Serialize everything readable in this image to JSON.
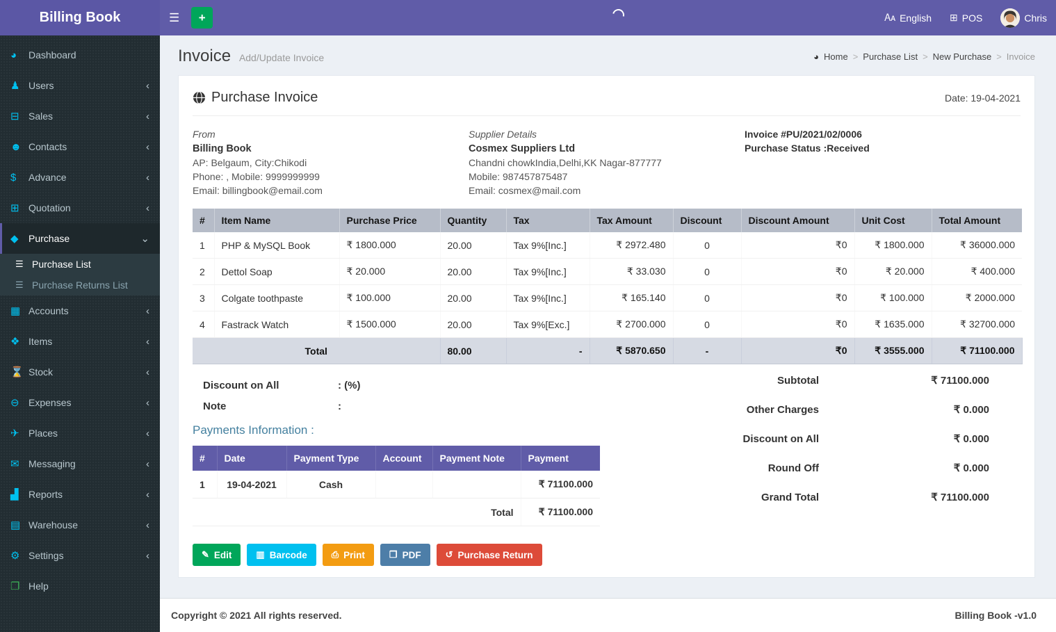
{
  "header": {
    "brand": "Billing Book",
    "language_label": "English",
    "pos_label": "POS",
    "user_name": "Chris",
    "icons": [
      "hamburger-icon",
      "plus-icon",
      "language-icon",
      "pos-plus-icon",
      "avatar",
      "loading-spinner"
    ]
  },
  "colors": {
    "navbar_purple": "#605ca8",
    "sidebar_dark": "#222d32",
    "icon_cyan": "#00c0ef",
    "green": "#00a65a",
    "orange": "#f39c12",
    "pdf_blue": "#4d7ea8",
    "red": "#dd4b39",
    "items_header_gray": "#b6bcc8",
    "total_row_gray": "#d6dae3"
  },
  "sidebar": {
    "items": [
      {
        "label": "Dashboard",
        "icon": "gauge-icon"
      },
      {
        "label": "Users",
        "icon": "user-plus-icon"
      },
      {
        "label": "Sales",
        "icon": "cart-icon"
      },
      {
        "label": "Contacts",
        "icon": "people-icon"
      },
      {
        "label": "Advance",
        "icon": "dollar-icon"
      },
      {
        "label": "Quotation",
        "icon": "calendar-plus-icon"
      },
      {
        "label": "Purchase",
        "icon": "cube-icon",
        "active": true,
        "expanded": true
      },
      {
        "label": "Accounts",
        "icon": "grid-icon"
      },
      {
        "label": "Items",
        "icon": "cubes-icon"
      },
      {
        "label": "Stock",
        "icon": "hourglass-icon"
      },
      {
        "label": "Expenses",
        "icon": "minus-circle-icon"
      },
      {
        "label": "Places",
        "icon": "paper-plane-icon"
      },
      {
        "label": "Messaging",
        "icon": "envelope-icon"
      },
      {
        "label": "Reports",
        "icon": "bar-chart-icon"
      },
      {
        "label": "Warehouse",
        "icon": "building-icon"
      },
      {
        "label": "Settings",
        "icon": "gears-icon"
      },
      {
        "label": "Help",
        "icon": "book-icon"
      }
    ],
    "purchase_submenu": [
      {
        "label": "Purchase List",
        "icon": "list-icon",
        "active": true
      },
      {
        "label": "Purchase Returns List",
        "icon": "list-icon",
        "active": false
      }
    ]
  },
  "page": {
    "title": "Invoice",
    "subtitle": "Add/Update Invoice",
    "breadcrumb": [
      {
        "label": "Home"
      },
      {
        "label": "Purchase List"
      },
      {
        "label": "New Purchase"
      },
      {
        "label": "Invoice"
      }
    ]
  },
  "invoice": {
    "title": "Purchase Invoice",
    "date": "Date: 19-04-2021",
    "from": {
      "heading": "From",
      "name": "Billing Book",
      "address": "AP: Belgaum, City:Chikodi",
      "phone": "Phone: , Mobile: 9999999999",
      "email": "Email: billingbook@email.com"
    },
    "supplier": {
      "heading": "Supplier Details",
      "name": "Cosmex Suppliers Ltd",
      "address": "Chandni chowkIndia,Delhi,KK Nagar-877777",
      "mobile": "Mobile: 987457875487",
      "email": "Email: cosmex@mail.com"
    },
    "meta": {
      "invoice_no": "Invoice #PU/2021/02/0006",
      "status": "Purchase Status :Received"
    }
  },
  "items_table": {
    "headers": [
      "#",
      "Item Name",
      "Purchase Price",
      "Quantity",
      "Tax",
      "Tax Amount",
      "Discount",
      "Discount Amount",
      "Unit Cost",
      "Total Amount"
    ],
    "rows": [
      [
        "1",
        "PHP & MySQL Book",
        "₹ 1800.000",
        "20.00",
        "Tax 9%[Inc.]",
        "₹ 2972.480",
        "0",
        "₹0",
        "₹ 1800.000",
        "₹ 36000.000"
      ],
      [
        "2",
        "Dettol Soap",
        "₹ 20.000",
        "20.00",
        "Tax 9%[Inc.]",
        "₹ 33.030",
        "0",
        "₹0",
        "₹ 20.000",
        "₹ 400.000"
      ],
      [
        "3",
        "Colgate toothpaste",
        "₹ 100.000",
        "20.00",
        "Tax 9%[Inc.]",
        "₹ 165.140",
        "0",
        "₹0",
        "₹ 100.000",
        "₹ 2000.000"
      ],
      [
        "4",
        "Fastrack Watch",
        "₹ 1500.000",
        "20.00",
        "Tax 9%[Exc.]",
        "₹ 2700.000",
        "0",
        "₹0",
        "₹ 1635.000",
        "₹ 32700.000"
      ]
    ],
    "total_row": {
      "label": "Total",
      "quantity": "80.00",
      "tax": "-",
      "tax_amount": "₹ 5870.650",
      "discount": "-",
      "discount_amount": "₹0",
      "unit_cost": "₹ 3555.000",
      "total_amount": "₹ 71100.000"
    }
  },
  "adjustments": {
    "discount_label": "Discount on All",
    "discount_value": ": (%)",
    "note_label": "Note",
    "note_value": ":"
  },
  "payments": {
    "heading": "Payments Information :",
    "headers": [
      "#",
      "Date",
      "Payment Type",
      "Account",
      "Payment Note",
      "Payment"
    ],
    "rows": [
      [
        "1",
        "19-04-2021",
        "Cash",
        "",
        "",
        "₹ 71100.000"
      ]
    ],
    "total_label": "Total",
    "total_value": "₹ 71100.000"
  },
  "summary": {
    "rows": [
      {
        "label": "Subtotal",
        "value": "₹ 71100.000"
      },
      {
        "label": "Other Charges",
        "value": "₹ 0.000"
      },
      {
        "label": "Discount on All",
        "value": "₹ 0.000"
      },
      {
        "label": "Round Off",
        "value": "₹ 0.000"
      },
      {
        "label": "Grand Total",
        "value": "₹ 71100.000"
      }
    ]
  },
  "actions": [
    {
      "label": "Edit",
      "icon": "edit-icon",
      "color": "#00a65a"
    },
    {
      "label": "Barcode",
      "icon": "barcode-icon",
      "color": "#00c0ef"
    },
    {
      "label": "Print",
      "icon": "printer-icon",
      "color": "#f39c12"
    },
    {
      "label": "PDF",
      "icon": "pdf-file-icon",
      "color": "#4d7ea8"
    },
    {
      "label": "Purchase Return",
      "icon": "undo-icon",
      "color": "#dd4b39"
    }
  ],
  "footer": {
    "left": "Copyright © 2021 All rights reserved.",
    "right": "Billing Book -v1.0"
  }
}
